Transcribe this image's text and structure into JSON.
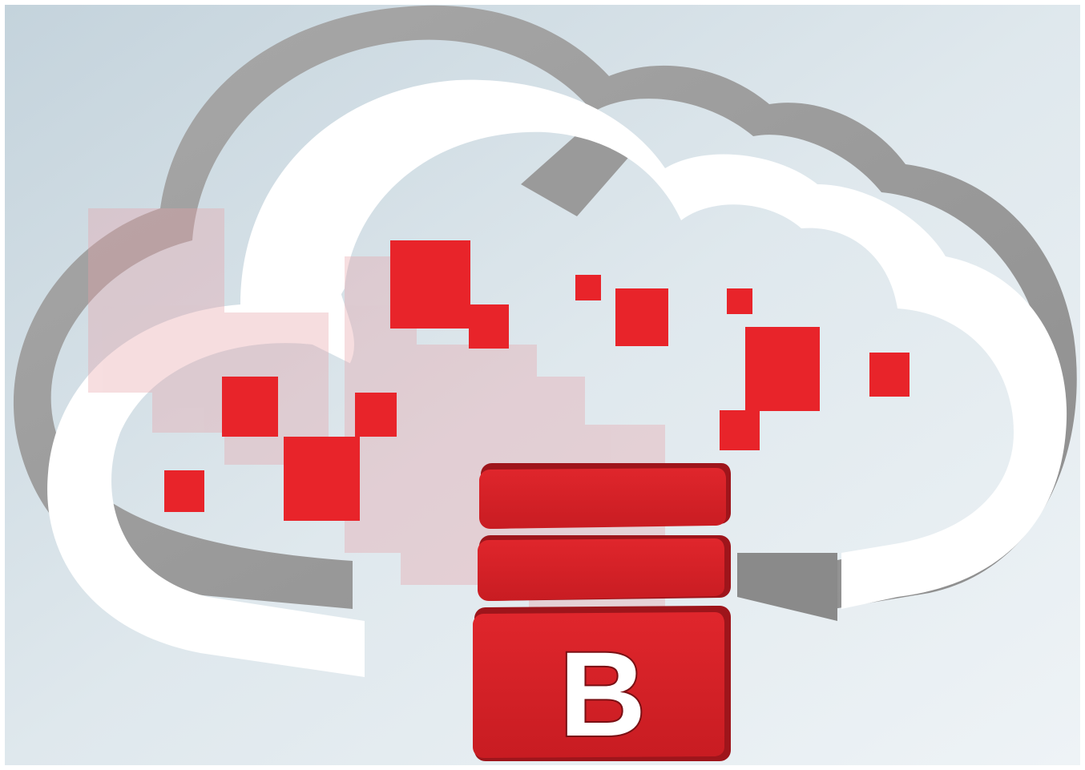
{
  "illustration": {
    "logo_letter": "B",
    "colors": {
      "background_light": "#e8eff3",
      "background_dark": "#b9cad4",
      "cloud_outline": "#ffffff",
      "cloud_extrusion": "#9c9c9c",
      "cloud_extrusion_dark": "#7f7f7f",
      "pixel_red": "#e8242a",
      "pixel_faded": "#e8a0a6",
      "stack_red": "#d51f26",
      "stack_red_dark": "#9e151b",
      "logo_white": "#ffffff"
    }
  }
}
